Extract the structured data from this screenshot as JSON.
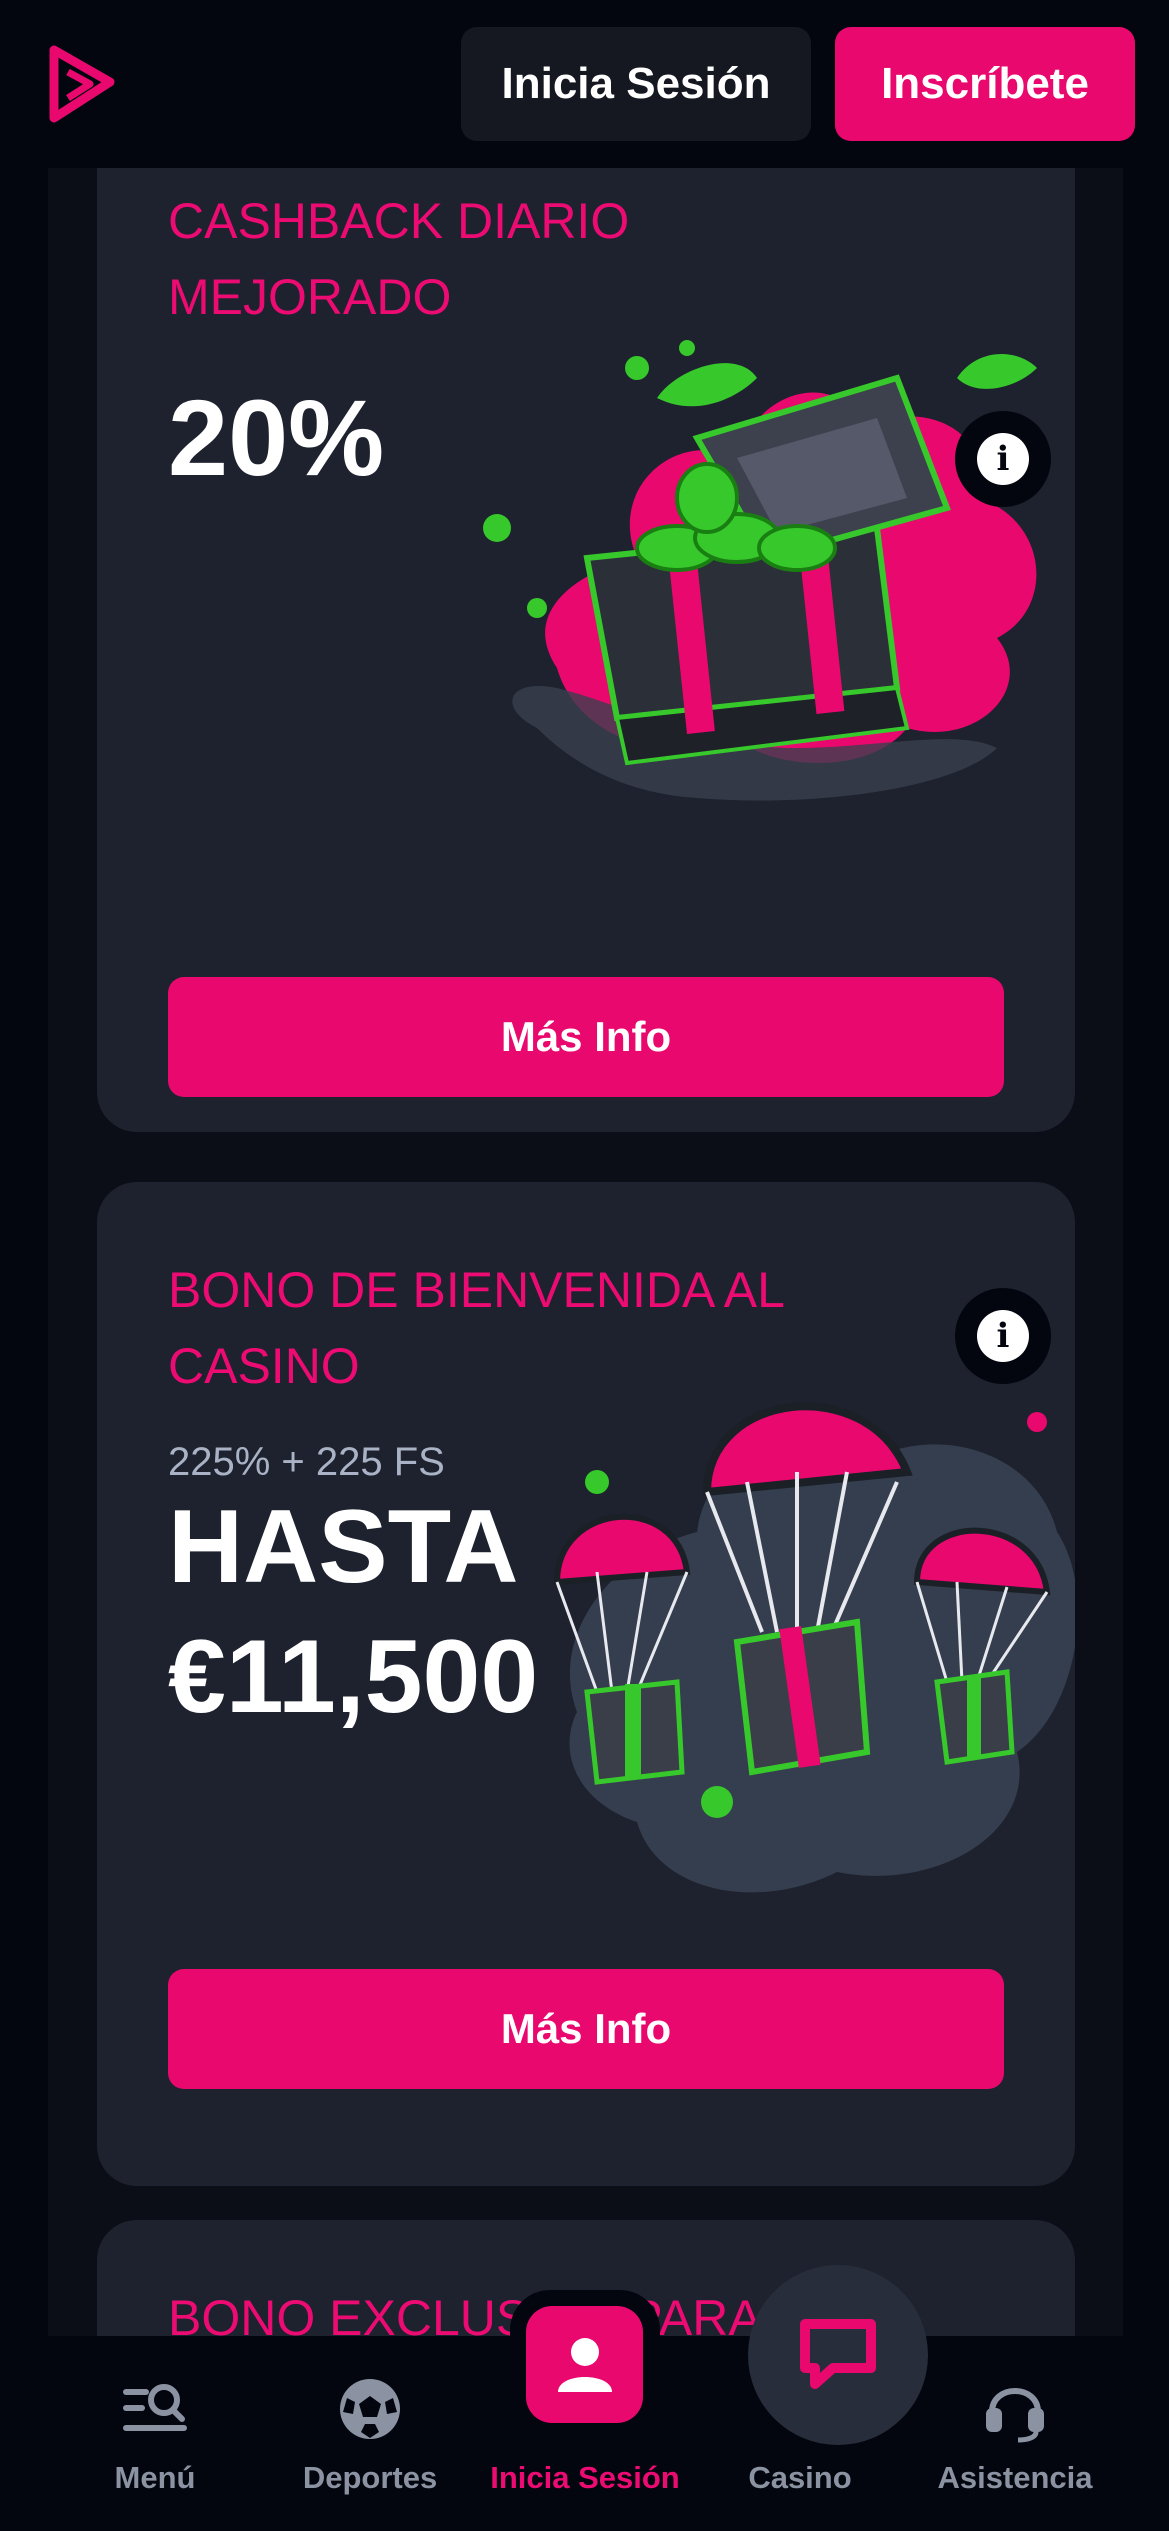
{
  "header": {
    "login_label": "Inicia Sesión",
    "signup_label": "Inscríbete",
    "logo_icon": "play-logo-icon",
    "accent_color": "#e9086e"
  },
  "promos": [
    {
      "title": "CASHBACK DIARIO MEJORADO",
      "value": "20%",
      "button_label": "Más Info",
      "art_icon": "treasure-chest-icon"
    },
    {
      "title": "BONO DE BIENVENIDA AL CASINO",
      "subtitle": "225% + 225 FS",
      "value": "HASTA €11,500",
      "button_label": "Más Info",
      "art_icon": "parachute-gifts-icon"
    },
    {
      "title": "BONO EXCLUSIVO PARA"
    }
  ],
  "bottom_nav": {
    "items": [
      {
        "label": "Menú",
        "icon": "menu-search-icon"
      },
      {
        "label": "Deportes",
        "icon": "soccer-ball-icon"
      },
      {
        "label": "Inicia Sesión",
        "icon": "user-icon"
      },
      {
        "label": "Casino",
        "icon": "casino-icon"
      },
      {
        "label": "Asistencia",
        "icon": "headset-icon"
      }
    ],
    "active_color": "#ec0b72",
    "chat_icon": "chat-bubble-icon"
  }
}
